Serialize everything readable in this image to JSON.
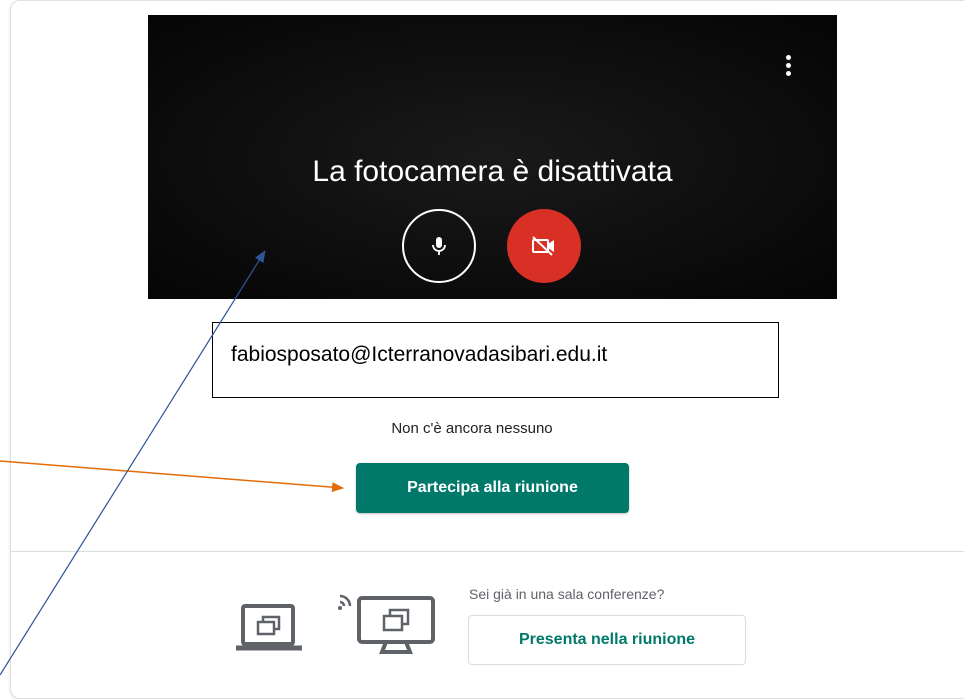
{
  "video": {
    "message": "La fotocamera è disattivata",
    "more_icon": "more-vert-icon",
    "mic_icon": "microphone-icon",
    "camera_icon": "camera-off-icon",
    "camera_status_color": "#d93025"
  },
  "account": {
    "email": "fabiosposato@Icterranovadasibari.edu.it"
  },
  "meeting": {
    "status": "Non c'è ancora nessuno",
    "join_label": "Partecipa alla riunione",
    "join_color": "#00796b"
  },
  "conference_room": {
    "question": "Sei già in una sala conferenze?",
    "present_label": "Presenta nella riunione",
    "illustration_icon": "cast-to-screen-icon"
  },
  "annotations": {
    "orange_arrow_color": "#e36c09",
    "blue_arrow_color": "#2f5597"
  }
}
